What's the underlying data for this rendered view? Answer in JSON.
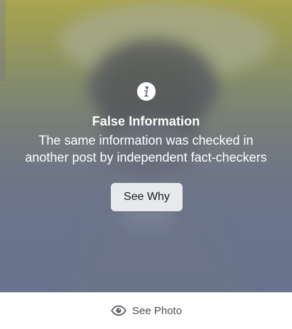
{
  "overlay": {
    "icon": "info-icon",
    "title": "False Information",
    "body_line_1": "The same information was checked in",
    "body_line_2": "another post by independent fact-checkers",
    "button_label": "See Why"
  },
  "footer": {
    "icon": "eye-icon",
    "label": "See Photo"
  },
  "colors": {
    "overlay_top": "#b9b146",
    "overlay_bottom": "#6c7793",
    "button_bg": "#e8e9eb",
    "button_text": "#1c1e21",
    "footer_text": "#4b4f56"
  }
}
